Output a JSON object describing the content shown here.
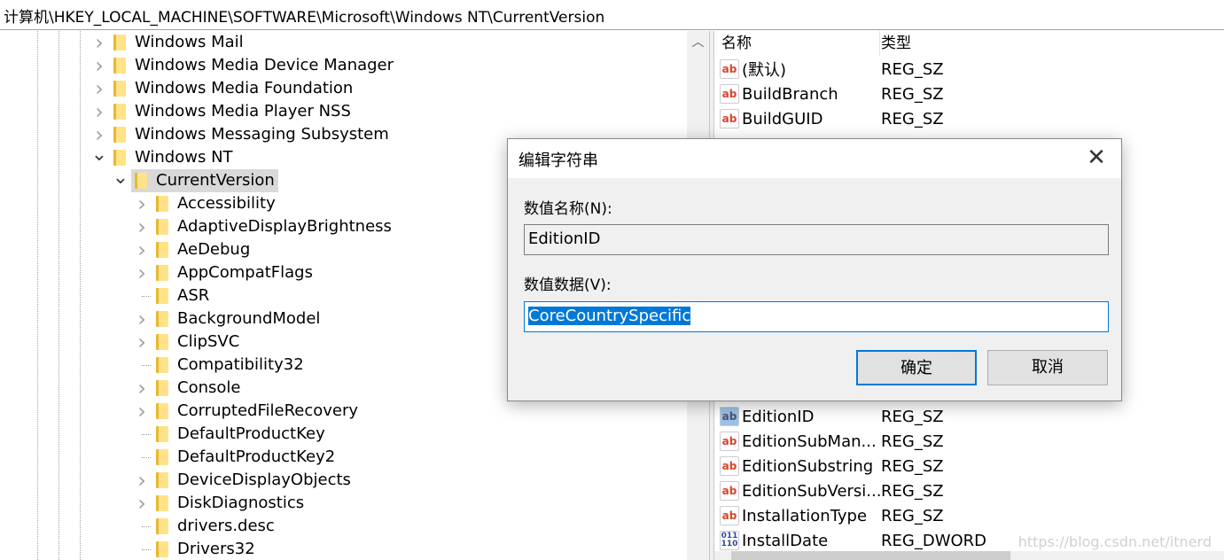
{
  "address": "计算机\\HKEY_LOCAL_MACHINE\\SOFTWARE\\Microsoft\\Windows NT\\CurrentVersion",
  "tree": [
    {
      "label": "Windows Mail",
      "level": 1,
      "expander": "collapsed"
    },
    {
      "label": "Windows Media Device Manager",
      "level": 1,
      "expander": "collapsed"
    },
    {
      "label": "Windows Media Foundation",
      "level": 1,
      "expander": "collapsed"
    },
    {
      "label": "Windows Media Player NSS",
      "level": 1,
      "expander": "collapsed"
    },
    {
      "label": "Windows Messaging Subsystem",
      "level": 1,
      "expander": "collapsed"
    },
    {
      "label": "Windows NT",
      "level": 1,
      "expander": "expanded"
    },
    {
      "label": "CurrentVersion",
      "level": 2,
      "expander": "expanded",
      "selected": true
    },
    {
      "label": "Accessibility",
      "level": 3,
      "expander": "collapsed"
    },
    {
      "label": "AdaptiveDisplayBrightness",
      "level": 3,
      "expander": "collapsed"
    },
    {
      "label": "AeDebug",
      "level": 3,
      "expander": "collapsed"
    },
    {
      "label": "AppCompatFlags",
      "level": 3,
      "expander": "collapsed"
    },
    {
      "label": "ASR",
      "level": 3,
      "expander": "none"
    },
    {
      "label": "BackgroundModel",
      "level": 3,
      "expander": "collapsed"
    },
    {
      "label": "ClipSVC",
      "level": 3,
      "expander": "collapsed"
    },
    {
      "label": "Compatibility32",
      "level": 3,
      "expander": "none"
    },
    {
      "label": "Console",
      "level": 3,
      "expander": "collapsed"
    },
    {
      "label": "CorruptedFileRecovery",
      "level": 3,
      "expander": "collapsed"
    },
    {
      "label": "DefaultProductKey",
      "level": 3,
      "expander": "none"
    },
    {
      "label": "DefaultProductKey2",
      "level": 3,
      "expander": "none"
    },
    {
      "label": "DeviceDisplayObjects",
      "level": 3,
      "expander": "collapsed"
    },
    {
      "label": "DiskDiagnostics",
      "level": 3,
      "expander": "collapsed"
    },
    {
      "label": "drivers.desc",
      "level": 3,
      "expander": "none"
    },
    {
      "label": "Drivers32",
      "level": 3,
      "expander": "none"
    }
  ],
  "list": {
    "col_name": "名称",
    "col_type": "类型",
    "rows_top": [
      {
        "name": "(默认)",
        "type": "REG_SZ",
        "icon": "string-value-icon"
      },
      {
        "name": "BuildBranch",
        "type": "REG_SZ",
        "icon": "string-value-icon"
      },
      {
        "name": "BuildGUID",
        "type": "REG_SZ",
        "icon": "string-value-icon"
      }
    ],
    "rows_bottom": [
      {
        "name": "EditionID",
        "type": "REG_SZ",
        "icon": "string-value-icon",
        "selected": true
      },
      {
        "name": "EditionSubMan...",
        "type": "REG_SZ",
        "icon": "string-value-icon"
      },
      {
        "name": "EditionSubstring",
        "type": "REG_SZ",
        "icon": "string-value-icon"
      },
      {
        "name": "EditionSubVersi...",
        "type": "REG_SZ",
        "icon": "string-value-icon"
      },
      {
        "name": "InstallationType",
        "type": "REG_SZ",
        "icon": "string-value-icon"
      },
      {
        "name": "InstallDate",
        "type": "REG_DWORD",
        "icon": "binary-value-icon"
      }
    ]
  },
  "dialog": {
    "title": "编辑字符串",
    "name_label": "数值名称(N):",
    "name_value": "EditionID",
    "data_label": "数值数据(V):",
    "data_value": "CoreCountrySpecific",
    "ok": "确定",
    "cancel": "取消"
  },
  "watermark": "https://blog.csdn.net/itnerd",
  "colors": {
    "accent": "#0078d7",
    "selection": "#d9d9d9"
  }
}
